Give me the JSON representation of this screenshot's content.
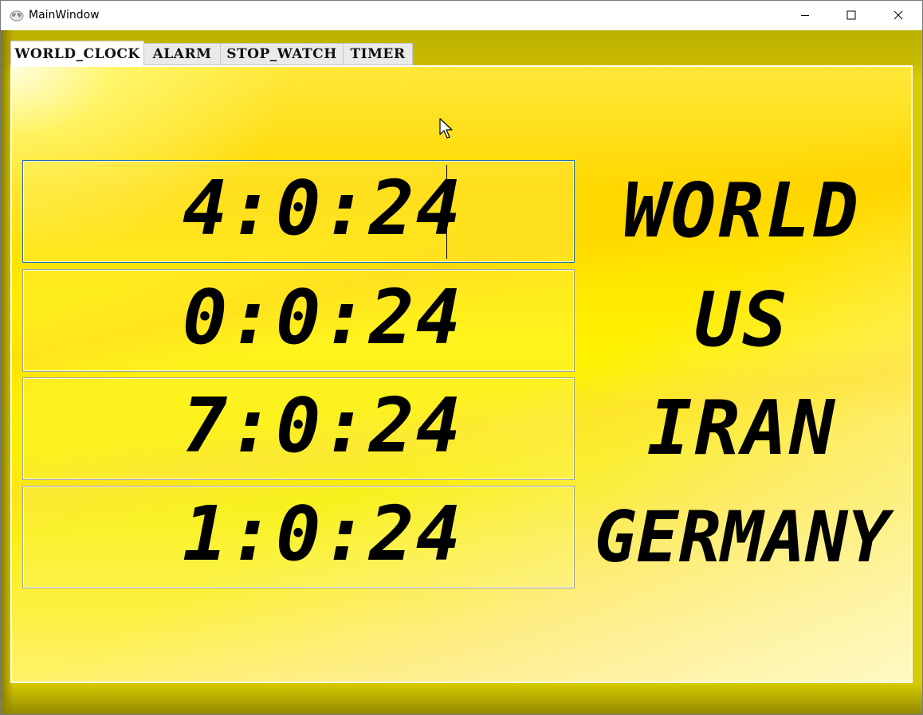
{
  "window": {
    "title": "MainWindow",
    "icons": {
      "app": "world-map-icon",
      "minimize": "minimize-icon",
      "maximize": "maximize-icon",
      "close": "close-icon"
    }
  },
  "tabs": [
    {
      "label": "WORLD_CLOCK",
      "active": true
    },
    {
      "label": "ALARM",
      "active": false
    },
    {
      "label": "STOP_WATCH",
      "active": false
    },
    {
      "label": "TIMER",
      "active": false
    }
  ],
  "world_clock": {
    "rows": [
      {
        "time": "4:0:24",
        "city": "WORLD"
      },
      {
        "time": "0:0:24",
        "city": "US"
      },
      {
        "time": "7:0:24",
        "city": "IRAN"
      },
      {
        "time": "1:0:24",
        "city": "GERMANY"
      }
    ]
  },
  "colors": {
    "frame": "#c9bc00",
    "panel_yellow": "#fff100",
    "focus_border": "#1b6fb3",
    "text": "#000000"
  }
}
